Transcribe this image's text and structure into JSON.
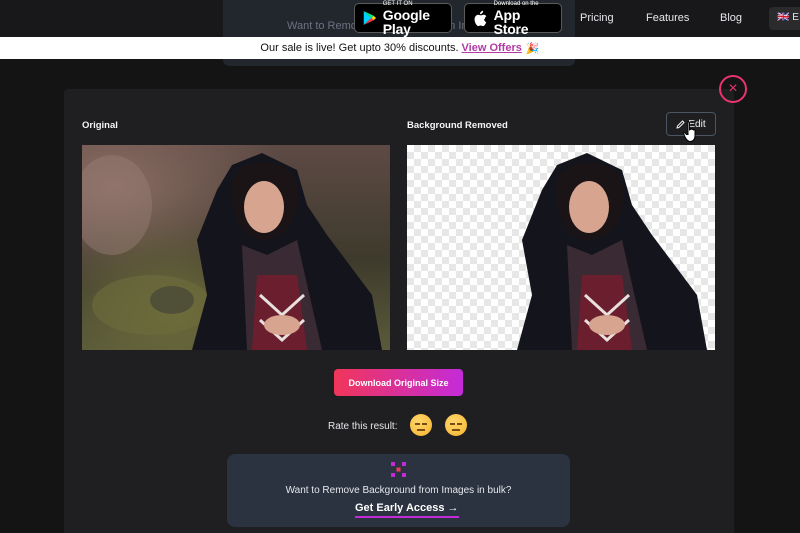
{
  "nav": {
    "bg_card_text": "Want to Remove Background from Images in bulk?",
    "google_play": {
      "small": "GET IT ON",
      "big": "Google Play"
    },
    "app_store": {
      "small": "Download on the",
      "big": "App Store"
    },
    "links": [
      "Pricing",
      "Features",
      "Blog"
    ],
    "lang": "🇬🇧 E"
  },
  "promo": {
    "text": "Our sale is live! Get upto 30% discounts.",
    "link": "View Offers",
    "emoji": "🎉"
  },
  "modal": {
    "close": "×",
    "original_label": "Original",
    "removed_label": "Background Removed",
    "edit_label": "Edit",
    "download_label": "Download Original Size",
    "rate_label": "Rate this result:",
    "bulk_text": "Want to Remove Background from Images in bulk?",
    "bulk_link": "Get Early Access →"
  },
  "colors": {
    "accent": "#e8336d",
    "gradient_start": "#f0365a",
    "gradient_end": "#c42bd8"
  }
}
